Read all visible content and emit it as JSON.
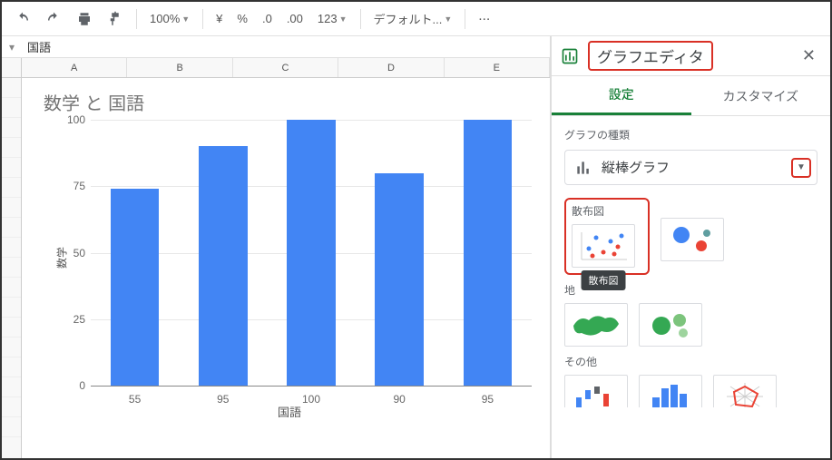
{
  "toolbar": {
    "zoom": "100%",
    "currency": "¥",
    "percent": "%",
    "dec_less": ".0",
    "dec_more": ".00",
    "num_fmt": "123",
    "font": "デフォルト...",
    "more": "⋯"
  },
  "fx": {
    "value": "国語"
  },
  "columns": [
    "A",
    "B",
    "C",
    "D",
    "E"
  ],
  "chart_data": {
    "type": "bar",
    "title": "数学 と 国語",
    "categories": [
      "55",
      "95",
      "100",
      "90",
      "95"
    ],
    "values": [
      74,
      90,
      100,
      80,
      100
    ],
    "xlabel": "国語",
    "ylabel": "数学",
    "yticks": [
      0,
      25,
      50,
      75,
      100
    ],
    "ylim": [
      0,
      100
    ]
  },
  "panel": {
    "title": "グラフエディタ",
    "tab_setup": "設定",
    "tab_customize": "カスタマイズ",
    "section_type": "グラフの種類",
    "type_selected": "縦棒グラフ",
    "section_scatter": "散布図",
    "tooltip_scatter": "散布図",
    "section_geo_prefix": "地",
    "section_other": "その他"
  }
}
